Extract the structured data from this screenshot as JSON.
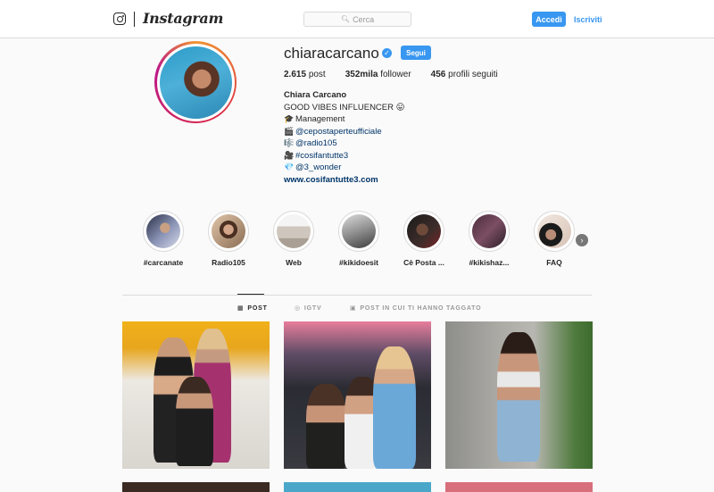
{
  "header": {
    "brand": "Instagram",
    "search_placeholder": "Cerca",
    "login_label": "Accedi",
    "signup_label": "Iscriviti"
  },
  "profile": {
    "username": "chiaracarcano",
    "verified_mark": "✓",
    "follow_label": "Segui",
    "stats": {
      "posts_value": "2.615",
      "posts_label": "post",
      "followers_value": "352mila",
      "followers_label": "follower",
      "following_value": "456",
      "following_label": "profili seguiti"
    },
    "bio": {
      "full_name": "Chiara Carcano",
      "line1": "GOOD VIBES INFLUENCER 😛",
      "line2": "Management",
      "line3": "@cepostaperteufficiale",
      "line4": "@radio105",
      "line5": "#cosifantutte3",
      "line6": "@3_wonder",
      "website": "www.cosifantutte3.com"
    }
  },
  "highlights": [
    {
      "label": "#carcanate"
    },
    {
      "label": "Radio105"
    },
    {
      "label": "Web"
    },
    {
      "label": "#kikidoesit"
    },
    {
      "label": "Cè Posta ..."
    },
    {
      "label": "#kikishaz..."
    },
    {
      "label": "FAQ"
    }
  ],
  "tabs": {
    "post": "POST",
    "igtv": "IGTV",
    "tagged": "POST IN CUI TI HANNO TAGGATO"
  },
  "colors": {
    "accent": "#3897f0",
    "border": "#dbdbdb",
    "background": "#fafafa",
    "text": "#262626"
  }
}
